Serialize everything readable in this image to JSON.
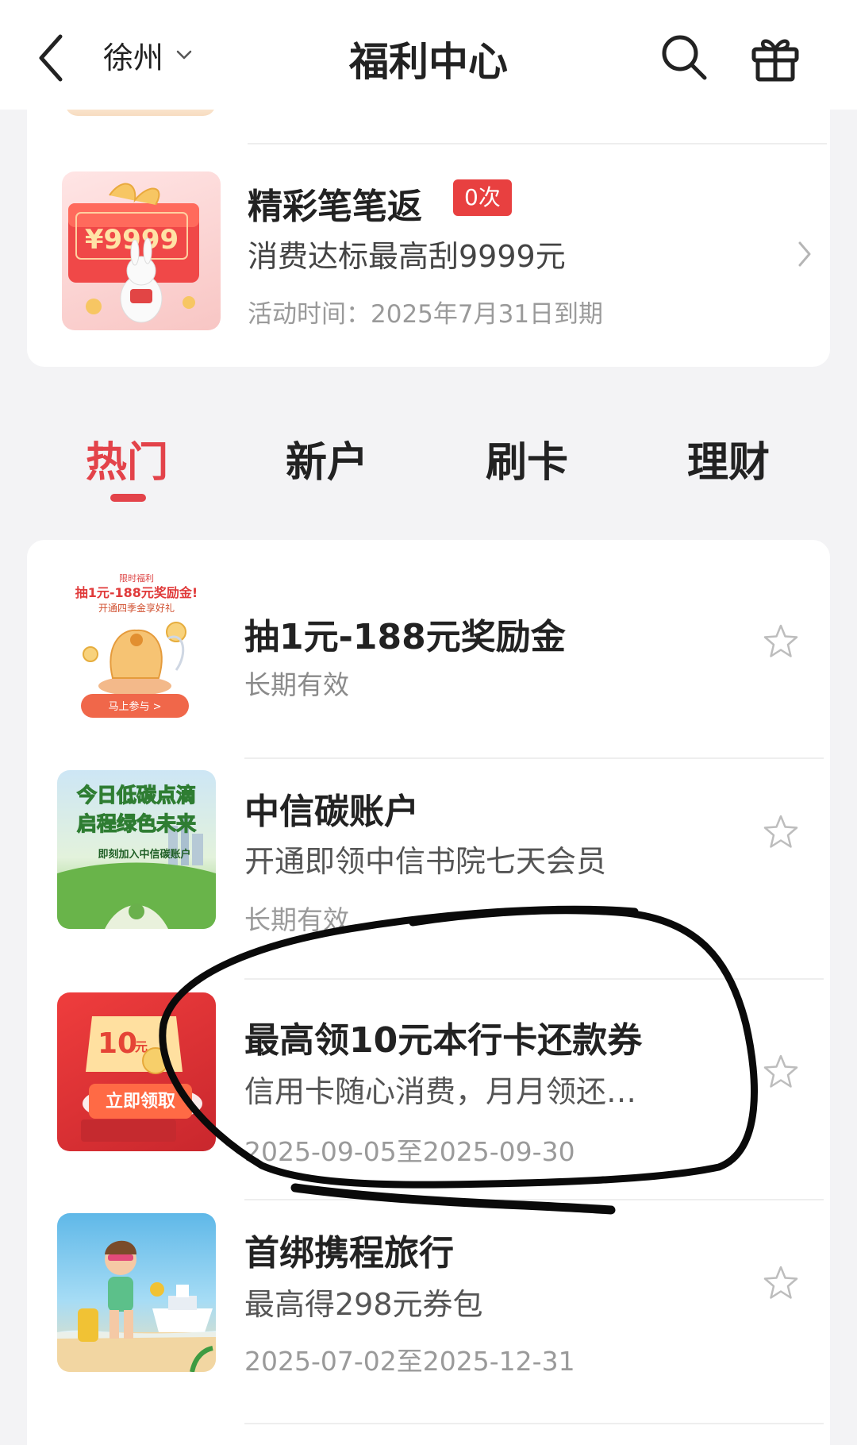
{
  "header": {
    "city": "徐州",
    "title": "福利中心"
  },
  "promo": {
    "title": "精彩笔笔返",
    "badge": "0次",
    "subtitle": "消费达标最高刮9999元",
    "time": "活动时间：2025年7月31日到期",
    "thumb_text": "¥9999"
  },
  "tabs": [
    "热门",
    "新户",
    "刷卡",
    "理财"
  ],
  "active_tab": "热门",
  "items": [
    {
      "title": "抽1元-188元奖励金",
      "sub": "长期有效",
      "date": "",
      "thumb": {
        "tag": "限时福利",
        "line1": "抽1元-188元奖励金!",
        "line2": "开通四季金享好礼",
        "button": "马上参与 >"
      }
    },
    {
      "title": "中信碳账户",
      "sub": "开通即领中信书院七天会员",
      "date": "长期有效",
      "thumb": {
        "line1": "今日低碳点滴",
        "line2": "启程绿色未来",
        "button": "即刻加入中信碳账户"
      }
    },
    {
      "title": "最高领10元本行卡还款券",
      "sub": "信用卡随心消费，月月领还…",
      "date": "2025-09-05至2025-09-30",
      "thumb": {
        "amount": "10",
        "unit": "元",
        "button": "立即领取"
      }
    },
    {
      "title": "首绑携程旅行",
      "sub": "最高得298元券包",
      "date": "2025-07-02至2025-12-31",
      "thumb": {}
    }
  ],
  "colors": {
    "accent": "#e3434a",
    "badge": "#e84040",
    "annotation": "#0a0a0a"
  }
}
